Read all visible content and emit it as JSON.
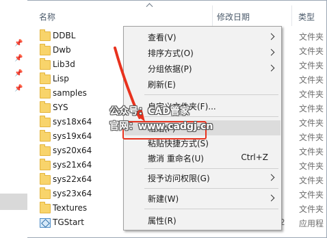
{
  "header": {
    "col_name": "名称",
    "col_date": "修改日期",
    "col_type": "类型"
  },
  "files": [
    {
      "name": "DDBL",
      "type": "文件夹",
      "icon": "folder-icon"
    },
    {
      "name": "Dwb",
      "type": "文件夹",
      "icon": "folder-icon"
    },
    {
      "name": "Lib3d",
      "type": "文件夹",
      "icon": "folder-icon"
    },
    {
      "name": "Lisp",
      "type": "文件夹",
      "icon": "folder-icon"
    },
    {
      "name": "samples",
      "type": "文件夹",
      "icon": "folder-icon"
    },
    {
      "name": "SYS",
      "type": "文件夹",
      "icon": "folder-icon"
    },
    {
      "name": "sys18x64",
      "type": "文件夹",
      "icon": "folder-icon"
    },
    {
      "name": "sys19x64",
      "type": "文件夹",
      "icon": "folder-icon"
    },
    {
      "name": "sys20x64",
      "type": "文件夹",
      "icon": "folder-icon"
    },
    {
      "name": "sys21x64",
      "type": "文件夹",
      "icon": "folder-icon"
    },
    {
      "name": "sys22x64",
      "type": "文件夹",
      "icon": "folder-icon"
    },
    {
      "name": "sys23x64",
      "type": "文件夹",
      "icon": "folder-icon"
    },
    {
      "name": "Textures",
      "type": "文件夹",
      "icon": "folder-icon"
    },
    {
      "name": "TGStart",
      "type": "应用程",
      "date_tail": "2",
      "icon": "app-icon"
    }
  ],
  "context_menu": {
    "view": "查看(V)",
    "sort": "排序方式(O)",
    "group": "分组依据(P)",
    "refresh": "刷新(E)",
    "customize": "自定义文件夹(F)...",
    "paste": "粘贴(P)",
    "paste_shortcut": "粘贴快捷方式(S)",
    "undo_rename": "撤消 重命名(U)",
    "undo_shortcut": "Ctrl+Z",
    "grant_access": "授予访问权限(G)",
    "new": "新建(W)",
    "properties": "属性(R)"
  },
  "watermark": {
    "line1": "公众号：CAD管家",
    "line2": "官网：www.cadgj.cn"
  },
  "colors": {
    "highlight_box": "#e8321e",
    "arrow": "#e8321e",
    "menu_bg": "#f2f2f2",
    "folder": "#f8d46b"
  }
}
